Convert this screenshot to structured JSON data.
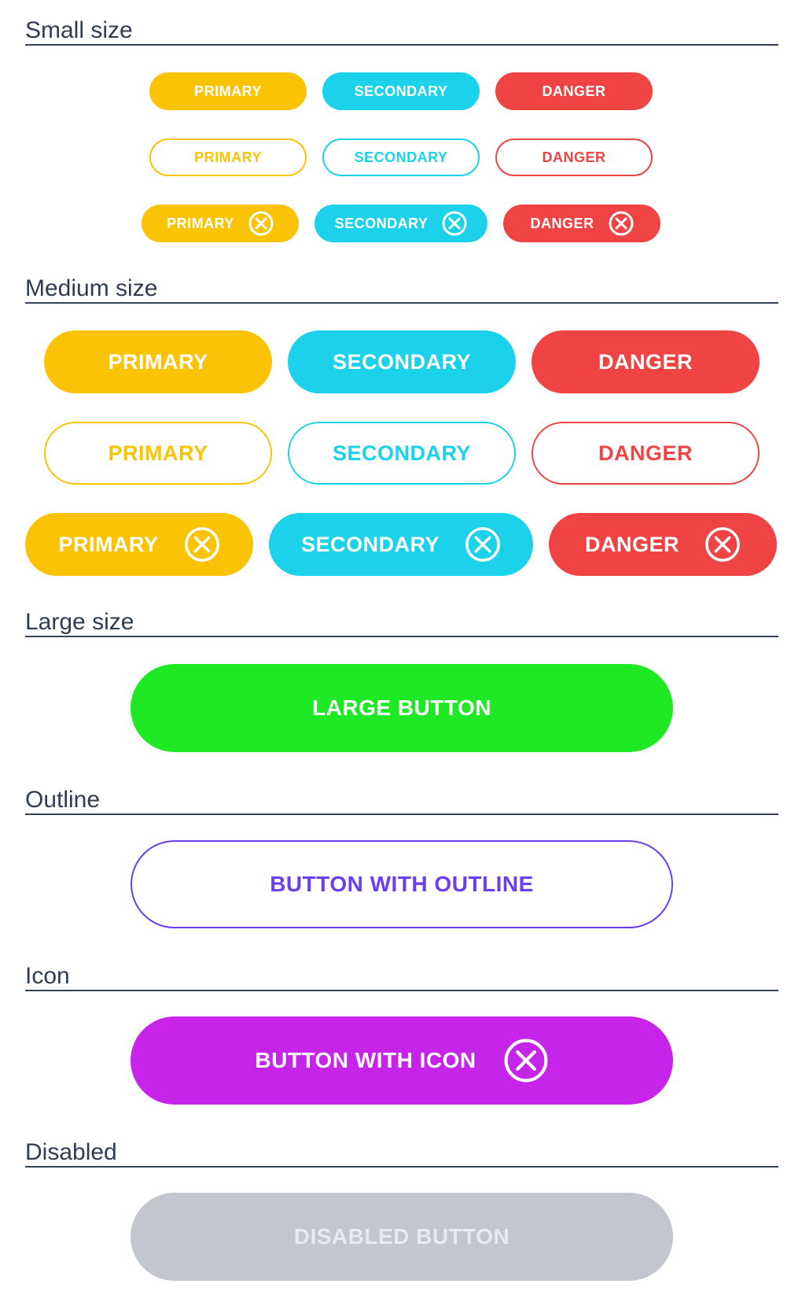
{
  "colors": {
    "primary": "#fac305",
    "secondary": "#1bd2ea",
    "danger": "#f04444",
    "large": "#1ee924",
    "outline": "#6a3ff0",
    "icon_button": "#c624e8",
    "disabled_bg": "#c2c7ce",
    "disabled_text": "#e7eaee",
    "heading": "#2f3d52"
  },
  "sections": {
    "small": {
      "title": "Small size"
    },
    "medium": {
      "title": "Medium size"
    },
    "large": {
      "title": "Large size",
      "button_label": "LARGE BUTTON"
    },
    "outline": {
      "title": "Outline",
      "button_label": "BUTTON WITH OUTLINE"
    },
    "icon": {
      "title": "Icon",
      "button_label": "BUTTON WITH ICON",
      "icon": "close-circle-icon"
    },
    "disabled": {
      "title": "Disabled",
      "button_label": "DISABLED BUTTON"
    }
  },
  "labels": {
    "primary": "PRIMARY",
    "secondary": "SECONDARY",
    "danger": "DANGER"
  }
}
